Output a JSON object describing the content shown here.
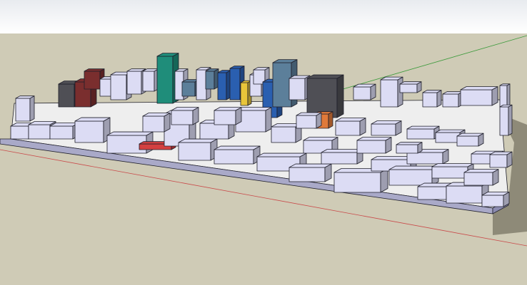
{
  "viewport": {
    "model": "city-block-3d-model",
    "sky_top_color": "#e8ebef",
    "sky_bottom_color": "#ffffff",
    "ground_color": "#cfcbb6",
    "base_color": "#eeeeee",
    "building_color": "#dcdcf4",
    "building_shade_color": "#a9a9c8",
    "shadow_color": "#8e8a78",
    "axis_red_color": "#c94a4a",
    "axis_green_color": "#3b9a3b",
    "accent_colors": {
      "teal_tower": "#1f8d7a",
      "blue_tower": "#2a5fb0",
      "glass_tower": "#5c7f9a",
      "dark_tower": "#4f4f55",
      "yellow_tower": "#e8c53a",
      "brick_building": "#7a2e2e",
      "red_roof": "#d44040",
      "orange_roof": "#e07a3a"
    }
  }
}
